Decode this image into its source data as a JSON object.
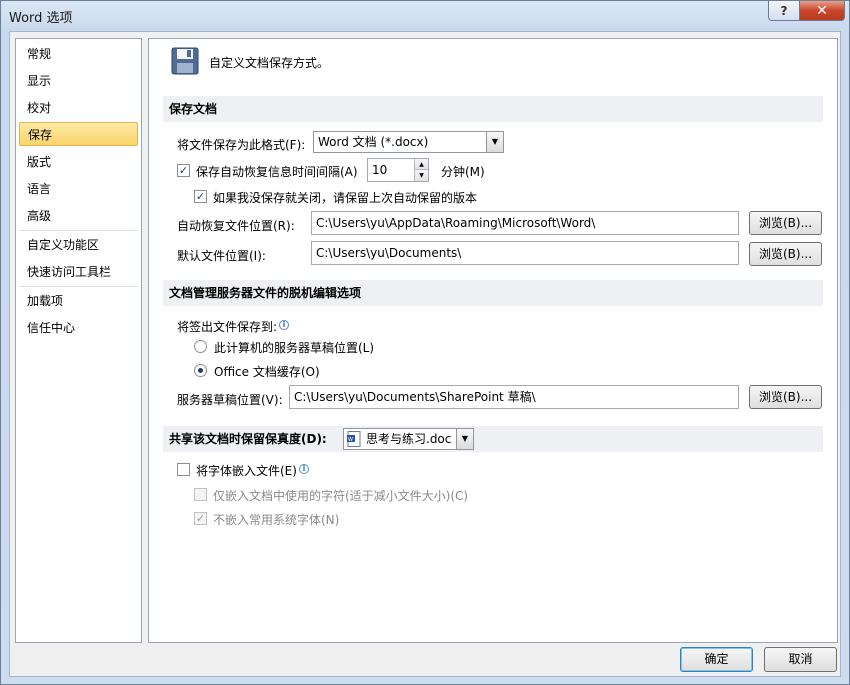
{
  "window": {
    "title": "Word 选项",
    "help_label": "?",
    "close_label": "✕"
  },
  "sidebar": {
    "items": [
      {
        "label": "常规"
      },
      {
        "label": "显示"
      },
      {
        "label": "校对"
      },
      {
        "label": "保存"
      },
      {
        "label": "版式"
      },
      {
        "label": "语言"
      },
      {
        "label": "高级"
      },
      {
        "label": "自定义功能区"
      },
      {
        "label": "快速访问工具栏"
      },
      {
        "label": "加载项"
      },
      {
        "label": "信任中心"
      }
    ],
    "selected": "保存"
  },
  "main": {
    "header": "自定义文档保存方式。",
    "save_section": {
      "title": "保存文档",
      "format_label": "将文件保存为此格式(F):",
      "format_value": "Word 文档 (*.docx)",
      "autorecover_label": "保存自动恢复信息时间间隔(A)",
      "autorecover_checked": true,
      "autorecover_minutes": "10",
      "minutes_label": "分钟(M)",
      "keep_last_label": "如果我没保存就关闭，请保留上次自动保留的版本",
      "keep_last_checked": true,
      "autorecover_location_label": "自动恢复文件位置(R):",
      "autorecover_location_value": "C:\\Users\\yu\\AppData\\Roaming\\Microsoft\\Word\\",
      "default_location_label": "默认文件位置(I):",
      "default_location_value": "C:\\Users\\yu\\Documents\\",
      "browse_label": "浏览(B)..."
    },
    "offline_section": {
      "title": "文档管理服务器文件的脱机编辑选项",
      "save_checkout_label": "将签出文件保存到:",
      "option_server_label": "此计算机的服务器草稿位置(L)",
      "option_cache_label": "Office 文档缓存(O)",
      "selected_option": "Office 文档缓存(O)",
      "drafts_label": "服务器草稿位置(V):",
      "drafts_value": "C:\\Users\\yu\\Documents\\SharePoint 草稿\\",
      "browse_label": "浏览(B)..."
    },
    "fidelity_section": {
      "title": "共享该文档时保留保真度(D):",
      "document_value": "思考与练习.doc",
      "embed_fonts_label": "将字体嵌入文件(E)",
      "embed_fonts_checked": false,
      "embed_used_chars_label": "仅嵌入文档中使用的字符(适于减小文件大小)(C)",
      "embed_used_chars_checked": false,
      "no_common_fonts_label": "不嵌入常用系统字体(N)",
      "no_common_fonts_checked": true
    }
  },
  "footer": {
    "ok_label": "确定",
    "cancel_label": "取消"
  },
  "colors": {
    "selected_nav": "#f9d56a",
    "section_bar": "#eef0f3",
    "close_button": "#c9472b"
  }
}
